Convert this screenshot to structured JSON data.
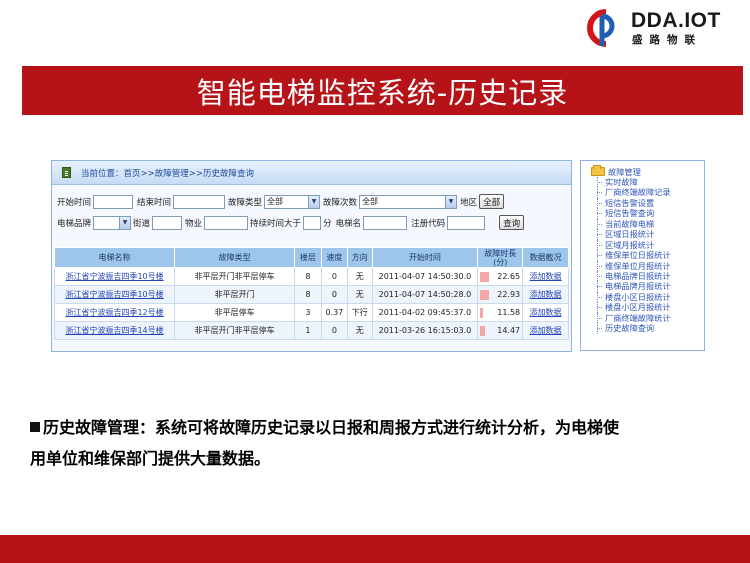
{
  "logo": {
    "brand": "DDA.IOT",
    "subtitle": "盛路物联",
    "colors": {
      "red": "#d4141c",
      "blue": "#1f5fb0"
    }
  },
  "title": "智能电梯监控系统-历史记录",
  "panel": {
    "breadcrumb": "当前位置：首页>>故障管理>>历史故障查询",
    "filters_row1": {
      "start_time_label": "开始时间",
      "end_time_label": "结束时间",
      "fault_type_label": "故障类型",
      "fault_type_value": "全部",
      "fault_count_label": "故障次数",
      "fault_count_value": "全部",
      "region_label": "地区",
      "region_button": "全部"
    },
    "filters_row2": {
      "brand_label": "电梯品牌",
      "street_label": "街道",
      "property_label": "物业",
      "duration_label": "持续时间大于",
      "duration_unit": "分",
      "elevator_name_label": "电梯名",
      "reg_code_label": "注册代码",
      "query_button": "查询"
    },
    "table": {
      "headers": [
        "电梯名称",
        "故障类型",
        "楼层",
        "速度",
        "方向",
        "开始时间",
        "故障时長(分)",
        "数据截况"
      ],
      "rows": [
        {
          "name": "浙江省宁波振吉四季10号楼",
          "type": "非平层开门非平层停车",
          "floor": "8",
          "speed": "0",
          "direction": "无",
          "start": "2011-04-07 14:50:30.0",
          "duration": "22.65",
          "fill": 0.22,
          "action": "添加数据"
        },
        {
          "name": "浙江省宁波振吉四季10号楼",
          "type": "非平层开门",
          "floor": "8",
          "speed": "0",
          "direction": "无",
          "start": "2011-04-07 14:50:28.0",
          "duration": "22.93",
          "fill": 0.22,
          "action": "添加数据"
        },
        {
          "name": "浙江省宁波振吉四季12号楼",
          "type": "非平层停车",
          "floor": "3",
          "speed": "0.37",
          "direction": "下行",
          "start": "2011-04-02 09:45:37.0",
          "duration": "11.58",
          "fill": 0.08,
          "action": "添加数据"
        },
        {
          "name": "浙江省宁波振吉四季14号楼",
          "type": "非平层开门非平层停车",
          "floor": "1",
          "speed": "0",
          "direction": "无",
          "start": "2011-03-26 16:15:03.0",
          "duration": "14.47",
          "fill": 0.12,
          "action": "添加数据"
        }
      ]
    }
  },
  "tree": {
    "root": "故障管理",
    "items": [
      "实时故障",
      "厂商终端故障记录",
      "短信告警设置",
      "短信告警查询",
      "当前故障电梯",
      "区域日报统计",
      "区域月报统计",
      "维保单位日报统计",
      "维保单位月报统计",
      "电梯品牌日报统计",
      "电梯品牌月报统计",
      "楼盘小区日报统计",
      "楼盘小区月报统计",
      "厂商终端故障统计",
      "历史故障查询"
    ]
  },
  "description": {
    "line1": "历史故障管理：系统可将故障历史记录以日报和周报方式进行统计分析，为电梯使",
    "line2": "用单位和维保部门提供大量数据。"
  }
}
